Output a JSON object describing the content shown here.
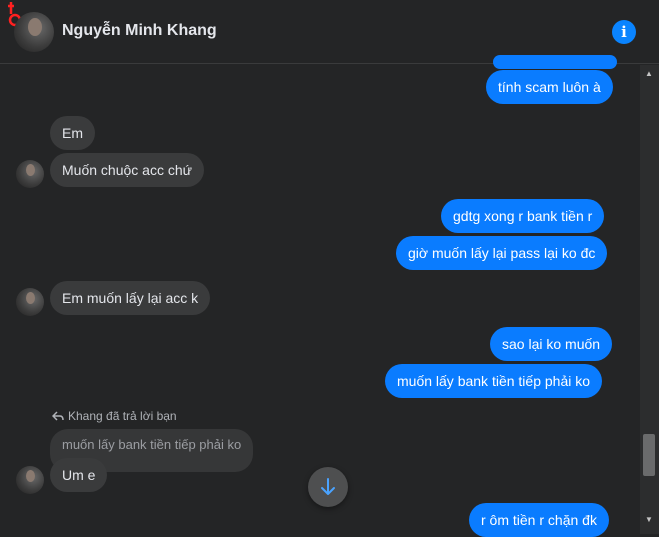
{
  "header": {
    "contact_name": "Nguyễn Minh Khang",
    "info_icon": "info-icon"
  },
  "messages": {
    "m1": "tính scam luôn à",
    "m2": "Em",
    "m3": "Muốn chuộc acc chứ",
    "m4": "gdtg xong r bank tiền r",
    "m5": "giờ muốn lấy lại pass lại ko đc",
    "m6": "Em muốn lấy lại acc k",
    "m7": "sao lại ko muốn",
    "m8": "muốn lấy bank tiền tiếp phải ko",
    "m9": "Um e",
    "m10": "r ôm tiền r chặn đk"
  },
  "reply": {
    "note": "Khang đã trả lời bạn",
    "quoted": "muốn lấy bank tiền tiếp phải ko"
  },
  "colors": {
    "outgoing": "#0a7cff",
    "incoming": "#3a3b3c",
    "background": "#242526"
  }
}
